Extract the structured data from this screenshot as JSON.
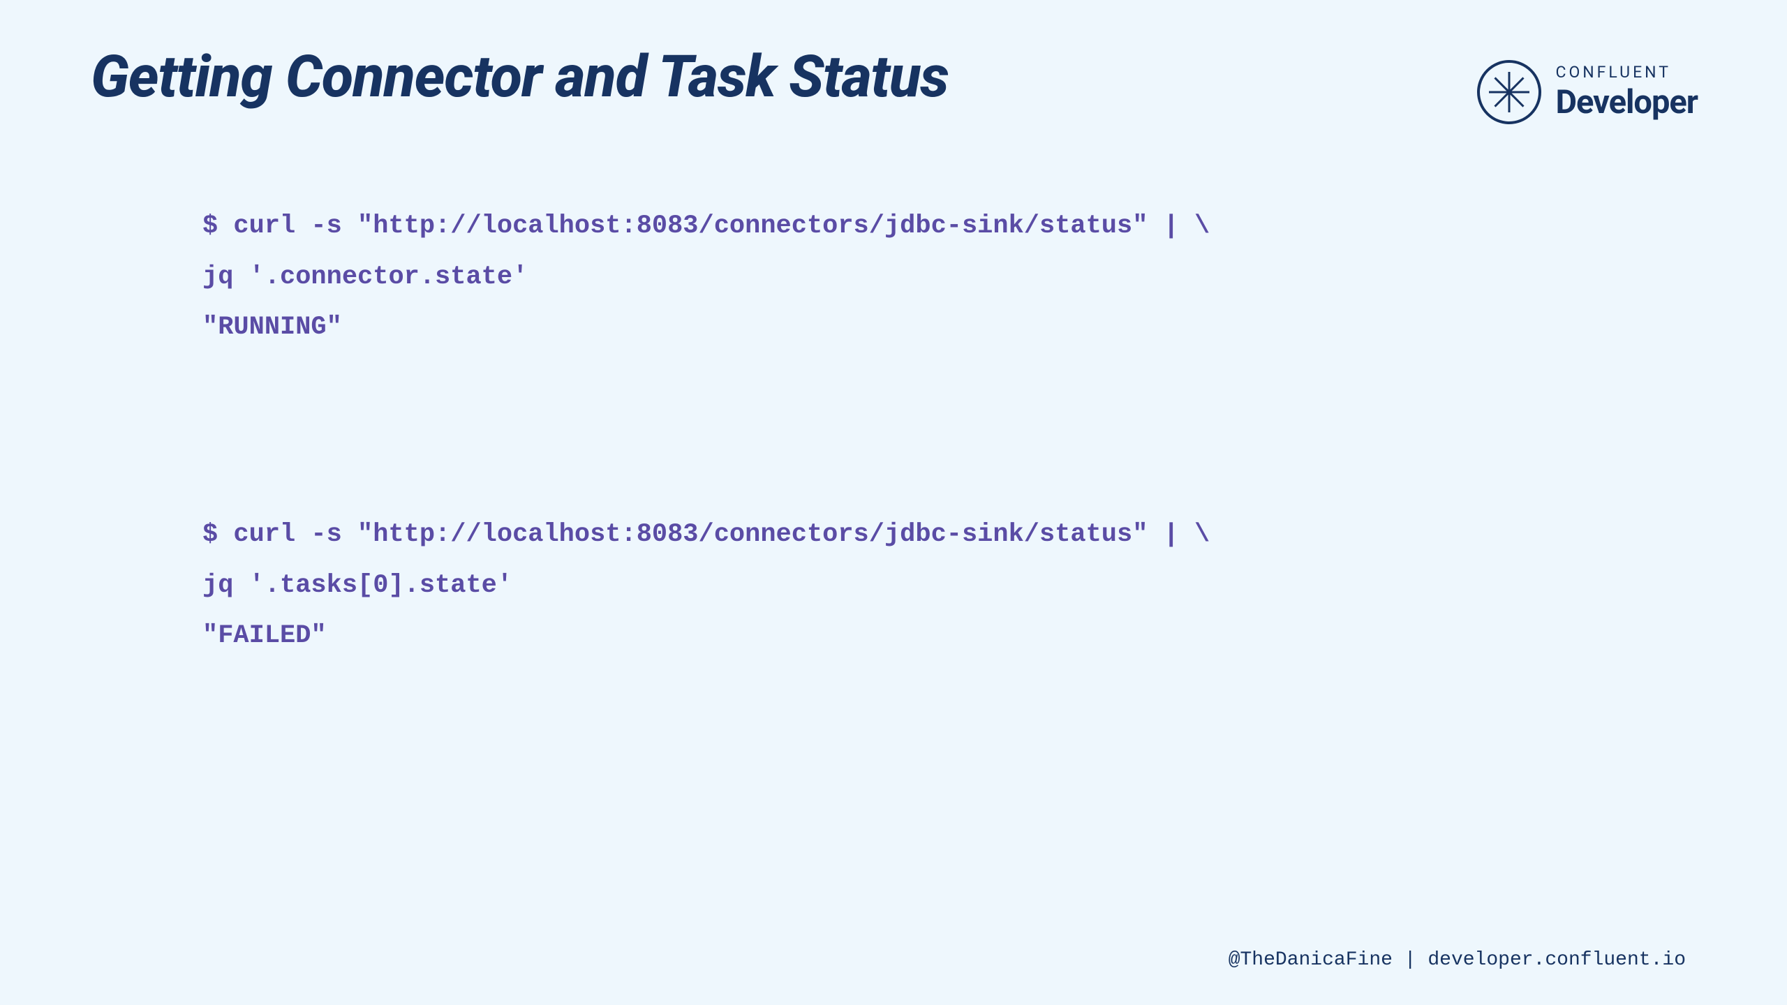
{
  "slide": {
    "title": "Getting Connector and Task Status"
  },
  "logo": {
    "brand_small": "CONFLUENT",
    "brand_large": "Developer"
  },
  "code_blocks": {
    "block1": {
      "line1": "$ curl -s \"http://localhost:8083/connectors/jdbc-sink/status\" | \\",
      "line2": "jq '.connector.state'",
      "line3": "\"RUNNING\""
    },
    "block2": {
      "line1": "$ curl -s \"http://localhost:8083/connectors/jdbc-sink/status\" | \\",
      "line2": "jq '.tasks[0].state'",
      "line3": "\"FAILED\""
    }
  },
  "footer": {
    "text": "@TheDanicaFine | developer.confluent.io"
  }
}
